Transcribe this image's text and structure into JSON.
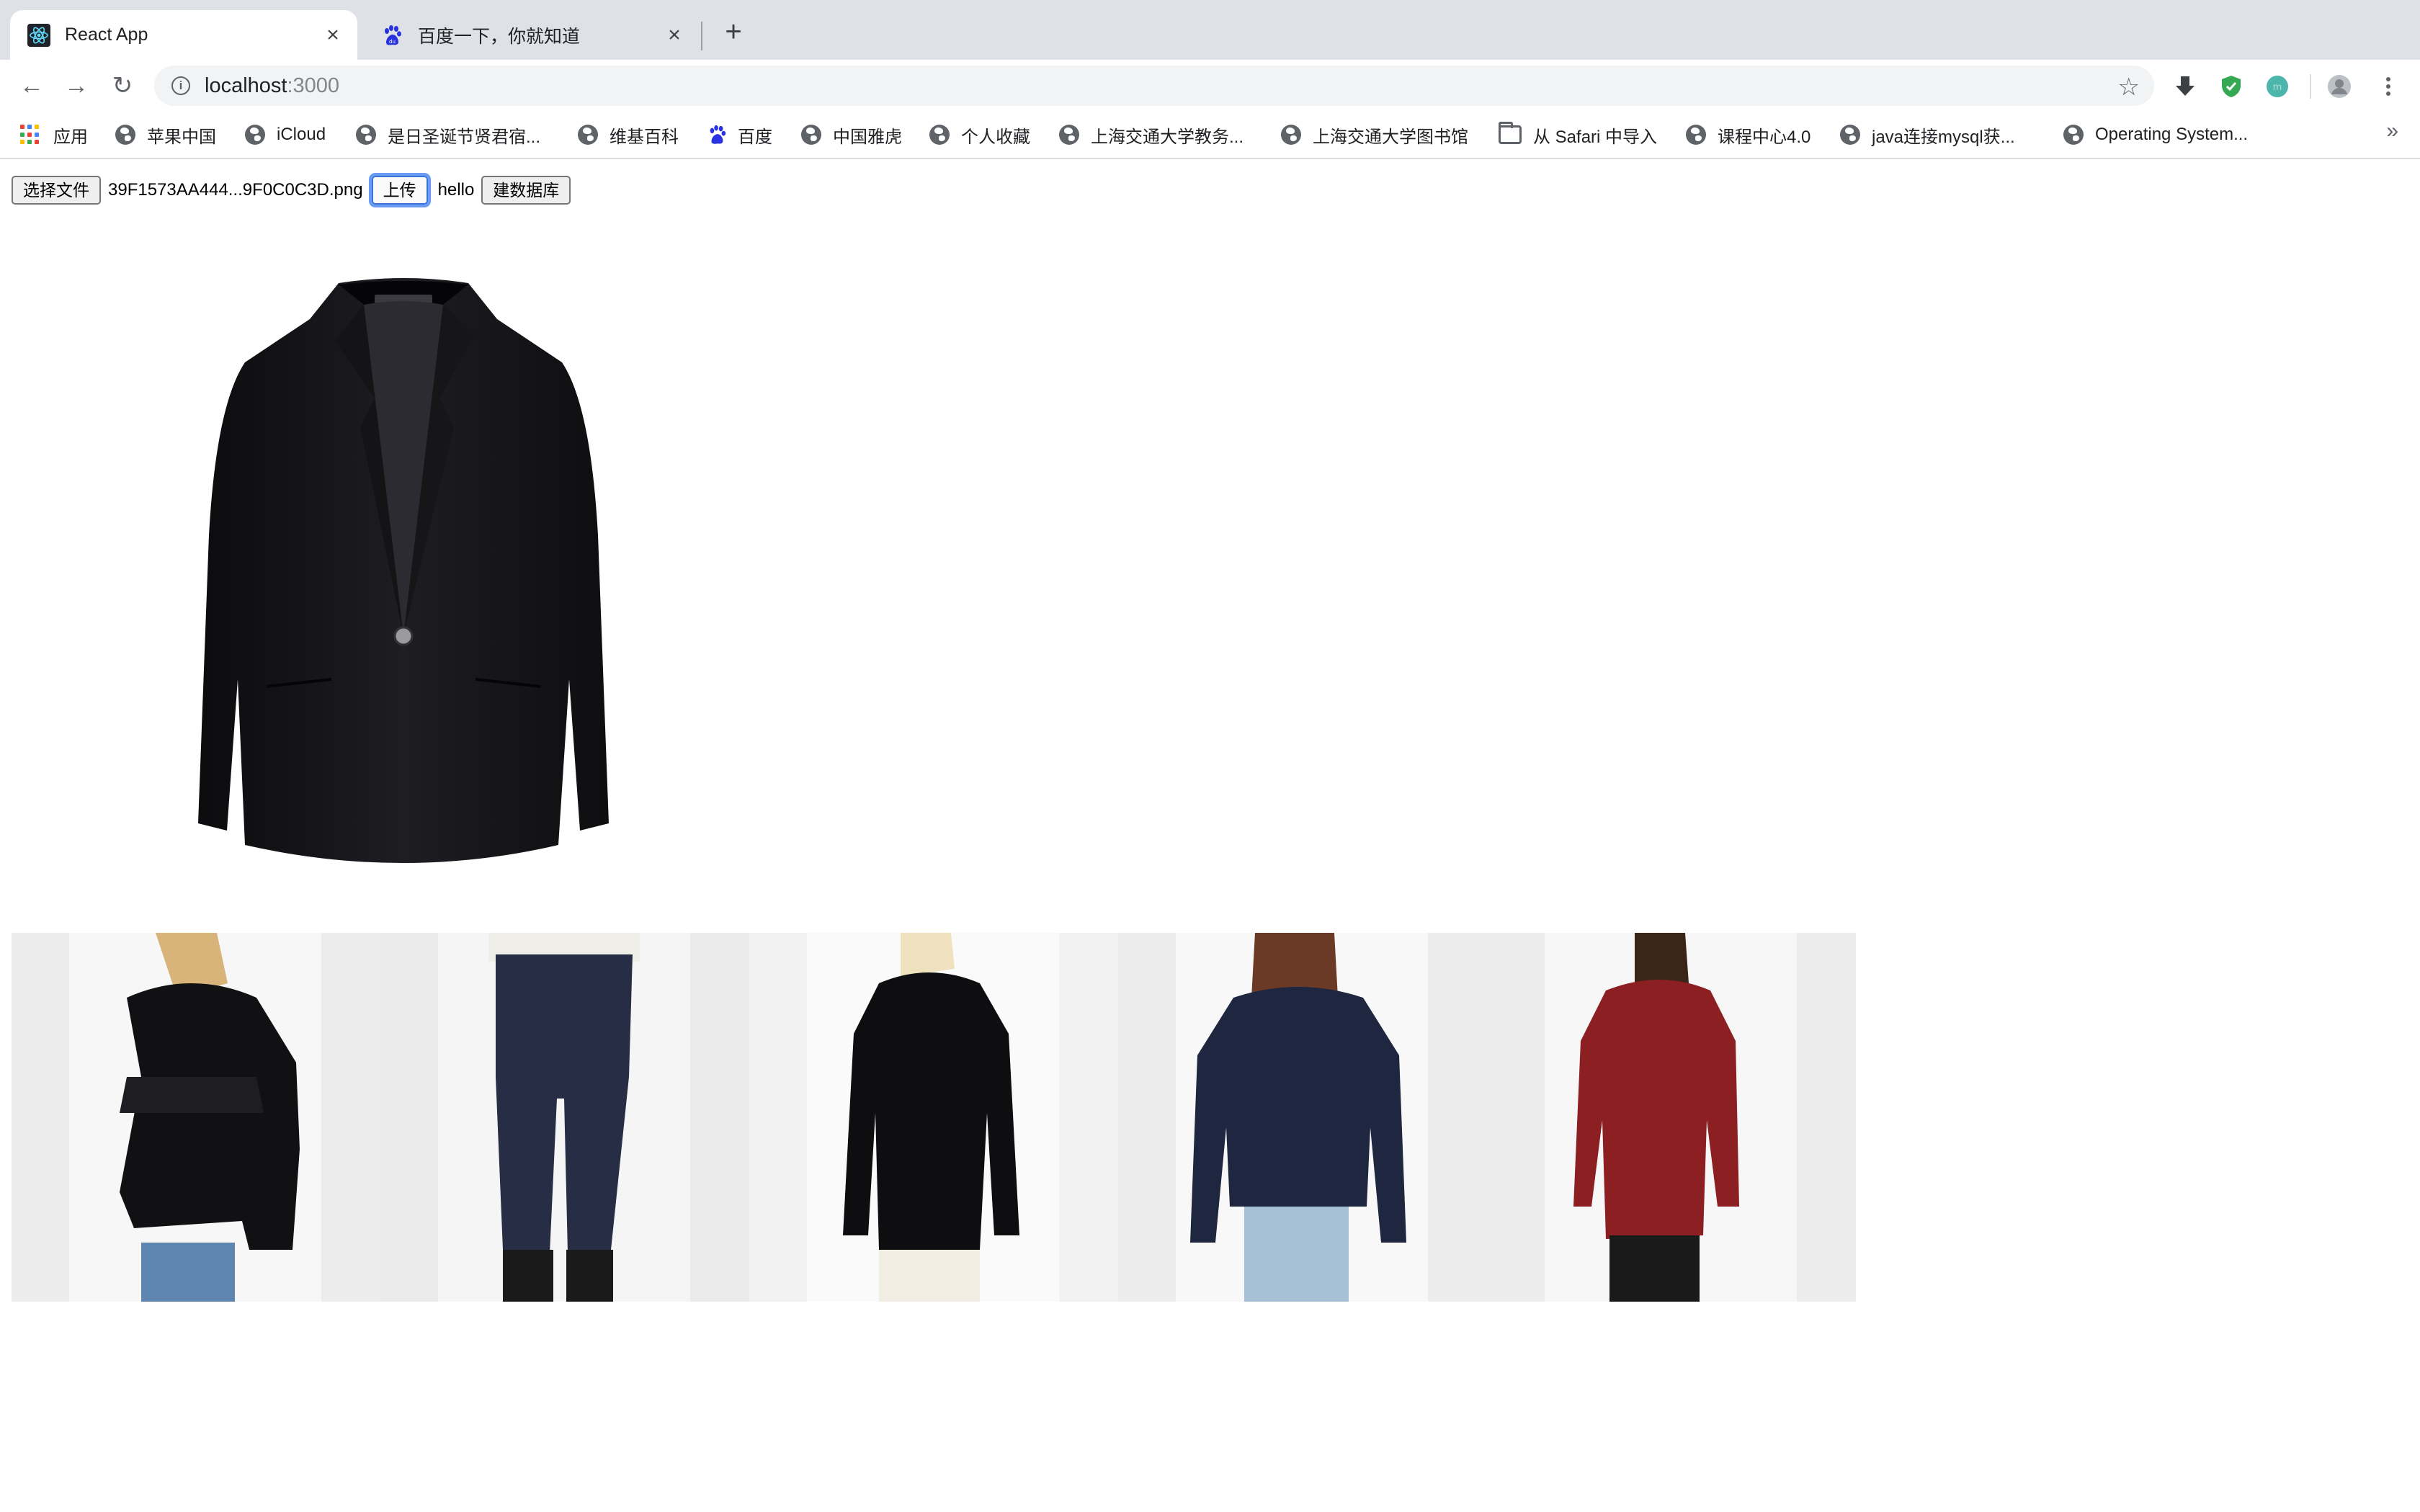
{
  "browser": {
    "tabs": [
      {
        "title": "React App",
        "active": true,
        "icon": "react-icon"
      },
      {
        "title": "百度一下，你就知道",
        "active": false,
        "icon": "baidu-paw-icon"
      }
    ],
    "close_glyph": "×",
    "new_tab_glyph": "+",
    "nav": {
      "back": "←",
      "forward": "→",
      "reload": "↻"
    },
    "address": {
      "host": "localhost",
      "port": ":3000"
    },
    "star_glyph": "☆",
    "bookmarks": [
      {
        "label": "应用",
        "icon": "apps-grid-icon"
      },
      {
        "label": "苹果中国",
        "icon": "globe-icon"
      },
      {
        "label": "iCloud",
        "icon": "globe-icon"
      },
      {
        "label": "是日圣诞节贤君宿...",
        "icon": "globe-icon"
      },
      {
        "label": "维基百科",
        "icon": "globe-icon"
      },
      {
        "label": "百度",
        "icon": "baidu-paw-icon"
      },
      {
        "label": "中国雅虎",
        "icon": "globe-icon"
      },
      {
        "label": "个人收藏",
        "icon": "globe-icon"
      },
      {
        "label": "上海交通大学教务...",
        "icon": "globe-icon"
      },
      {
        "label": "上海交通大学图书馆",
        "icon": "globe-icon"
      },
      {
        "label": "从 Safari 中导入",
        "icon": "folder-icon"
      },
      {
        "label": "课程中心4.0",
        "icon": "globe-icon"
      },
      {
        "label": "java连接mysql获...",
        "icon": "globe-icon"
      },
      {
        "label": "Operating System...",
        "icon": "globe-icon"
      }
    ],
    "overflow_glyph": "»"
  },
  "app": {
    "choose_file_label": "选择文件",
    "file_name": "39F1573AA444...9F0C0C3D.png",
    "upload_label": "上传",
    "hello_text": "hello",
    "build_db_label": "建数据库"
  },
  "images": {
    "hero": "black-blazer-product-photo",
    "gallery": [
      "model-back-black-jacket",
      "model-dark-flare-jeans",
      "model-back-black-sweater",
      "model-back-navy-jacket",
      "model-back-red-blouse"
    ]
  },
  "colors": {
    "tabstrip": "#dee1e6",
    "focus_ring": "#6a9bf4"
  }
}
